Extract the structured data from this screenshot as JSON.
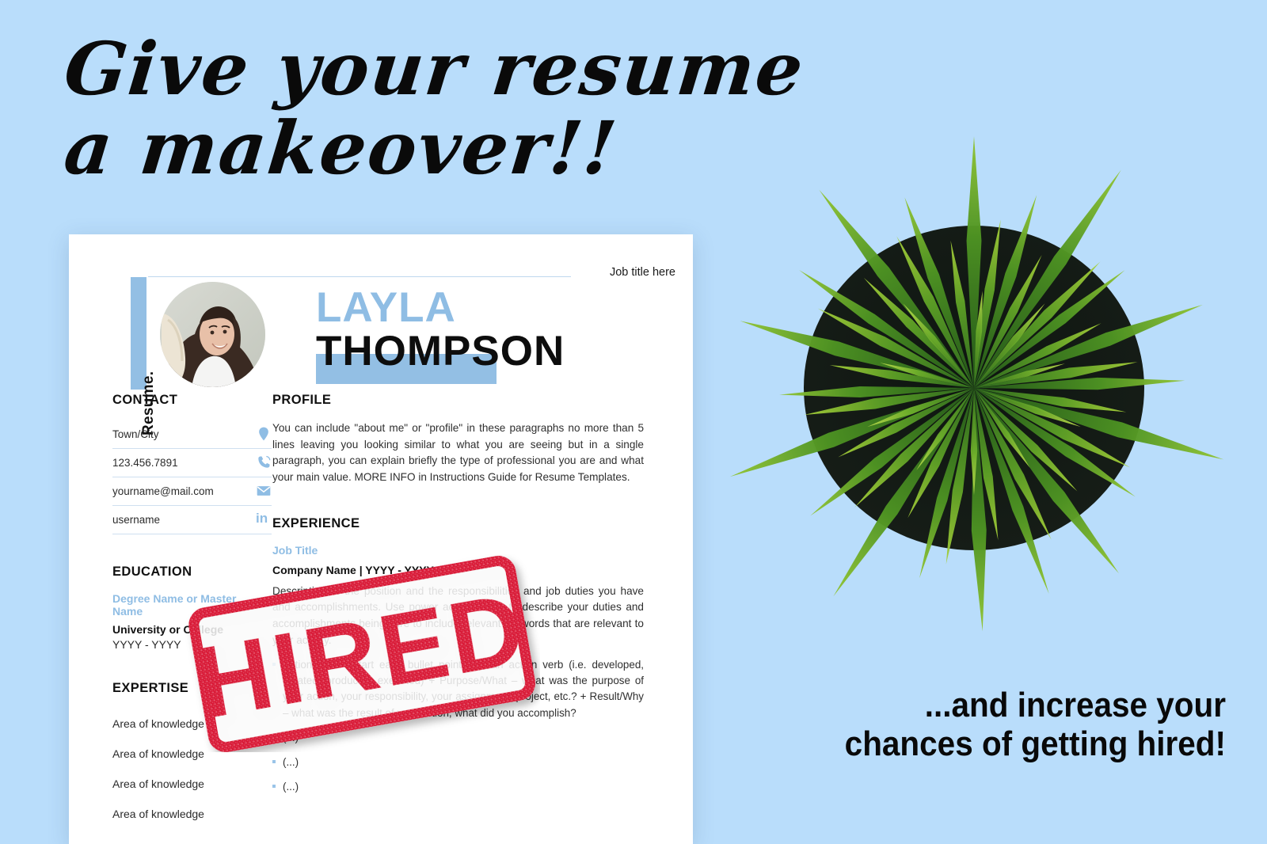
{
  "background_color": "#b9ddfb",
  "accent_color": "#8fbde4",
  "stamp_color": "#d81232",
  "headline": {
    "line1": "Give your resume",
    "line2": "a makeover!!"
  },
  "tagline": {
    "line1": "...and increase your",
    "line2": "chances of getting hired!"
  },
  "stamp": {
    "label": "HIRED"
  },
  "plant": {
    "alt": "potted-plant-top-view"
  },
  "resume": {
    "side_label": "Resume.",
    "job_title_top": "Job title here",
    "name_first": "LAYLA",
    "name_last": "THOMPSON",
    "portrait_alt": "profile-photo",
    "contact": {
      "heading": "CONTACT",
      "items": [
        {
          "value": "Town/City",
          "icon": "location-pin-icon"
        },
        {
          "value": "123.456.7891",
          "icon": "phone-icon"
        },
        {
          "value": "yourname@mail.com",
          "icon": "envelope-icon"
        },
        {
          "value": "username",
          "icon": "linkedin-icon"
        }
      ]
    },
    "education": {
      "heading": "EDUCATION",
      "degree": "Degree Name or Master Name",
      "school": "University or College",
      "years": "YYYY - YYYY"
    },
    "expertise": {
      "heading": "EXPERTISE",
      "items": [
        "Area of knowledge",
        "Area of knowledge",
        "Area of knowledge",
        "Area of knowledge"
      ]
    },
    "profile": {
      "heading": "PROFILE",
      "text": "You can include \"about me\" or \"profile\" in these paragraphs no more than 5 lines leaving you looking similar to what you are seeing but in a single paragraph, you can explain briefly the type of professional you are and what your main value. MORE INFO in Instructions Guide for Resume Templates."
    },
    "experience": {
      "heading": "EXPERIENCE",
      "job_title": "Job Title",
      "company": "Company Name | YYYY - YYYY",
      "description": "Description of the position and the responsibilities and job duties you have and accomplishments. Use power action words to describe your duties and accomplishments being sure to include relevant keywords that are relevant to your activity.",
      "bullets": [
        "Action/How – start each bullet point with an action verb (i.e. developed, created, produced, executed) + Purpose/What – what was the purpose of your action, your responsibility, your assignment, project, etc.? + Result/Why – what was the result of your action, what did you accomplish?",
        "(...)",
        "(...)",
        "(...)"
      ]
    }
  }
}
